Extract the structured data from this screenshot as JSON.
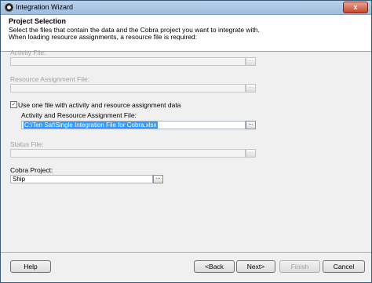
{
  "window": {
    "title": "Integration Wizard",
    "close_label": "x"
  },
  "header": {
    "title": "Project Selection",
    "description_line1": "Select the files that contain the data and the Cobra project you want to integrate with.",
    "description_line2": "When loading resource assignments, a resource file is required:"
  },
  "fields": {
    "activity_file_label": "Activity File:",
    "resource_assignment_label": "Resource Assignment File:",
    "single_file_checkbox_label": "Use one file with activity and resource assignment data",
    "single_file_checked": true,
    "activity_resource_label": "Activity and Resource Assignment File:",
    "activity_resource_value": "C:\\Ten Sat\\Single Integration File for Cobra.xlsx",
    "status_file_label": "Status File:",
    "cobra_project_label": "Cobra Project:",
    "cobra_project_value": "Ship"
  },
  "browse_label": "...",
  "buttons": {
    "help": "Help",
    "back": "<Back",
    "next": "Next>",
    "finish": "Finish",
    "cancel": "Cancel"
  }
}
